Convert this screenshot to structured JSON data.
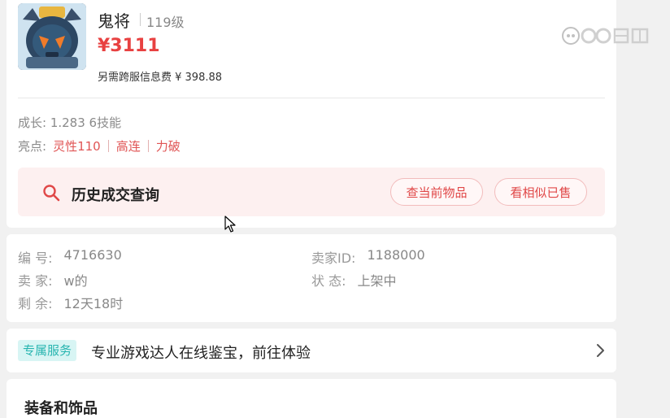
{
  "product": {
    "name": "鬼将",
    "level": "119级",
    "price": "¥3111",
    "fee": "另需跨服信息费 ¥ 398.88",
    "growth": "成长: 1.283 6技能",
    "highlights_label": "亮点:",
    "highlights": [
      "灵性110",
      "高连",
      "力破"
    ],
    "avatar_icon": "ghost-general-icon"
  },
  "history": {
    "title": "历史成交查询",
    "button_current": "查当前物品",
    "button_similar": "看相似已售",
    "accent_color": "#e04848"
  },
  "info": {
    "id_label": "编 号:",
    "id_value": "4716630",
    "seller_label": "卖 家:",
    "seller_value": "w的",
    "remaining_label": "剩 余:",
    "remaining_value": "12天18时",
    "seller_id_label": "卖家ID:",
    "seller_id_value": "1188000",
    "status_label": "状 态:",
    "status_value": "上架中"
  },
  "service": {
    "badge": "专属服务",
    "text": "专业游戏达人在线鉴宝，前往体验",
    "arrow_icon": "chevron-right-icon"
  },
  "equipment": {
    "title": "装备和饰品"
  },
  "watermark": {
    "text": "CC直播"
  }
}
